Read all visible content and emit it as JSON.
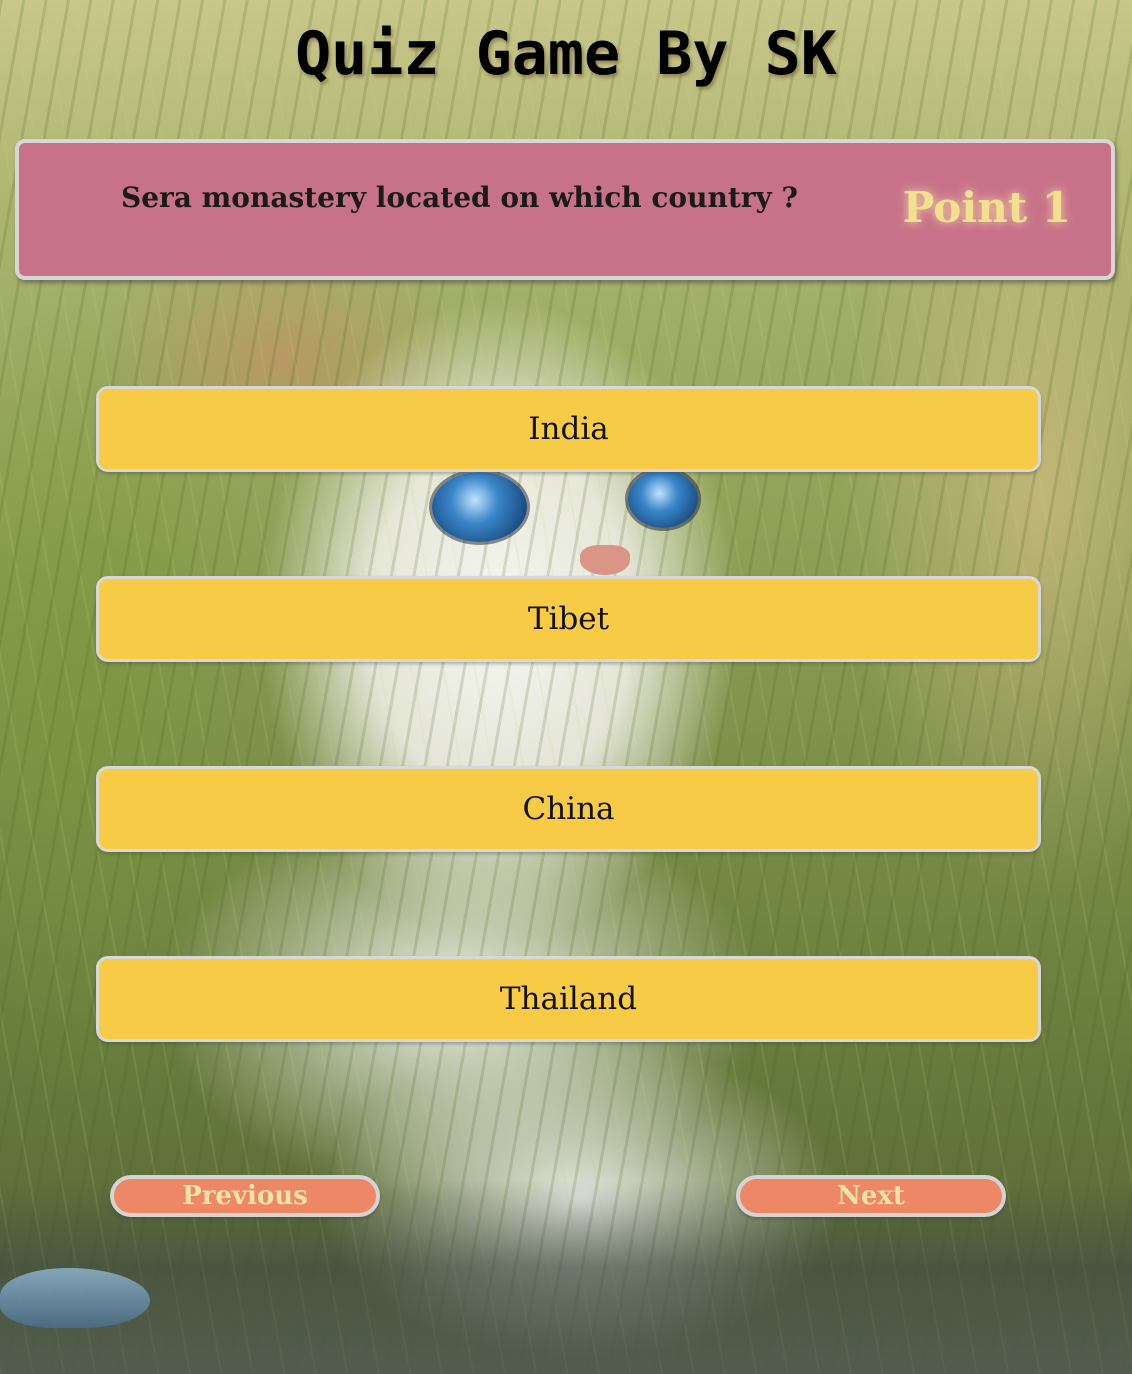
{
  "page": {
    "title": "Quiz Game By SK"
  },
  "question": {
    "text": "Sera monastery located on which country ?",
    "score_label": "Point 1"
  },
  "options": [
    {
      "label": "India"
    },
    {
      "label": "Tibet"
    },
    {
      "label": "China"
    },
    {
      "label": "Thailand"
    }
  ],
  "navigation": {
    "previous_label": "Previous",
    "next_label": "Next"
  },
  "colors": {
    "question_panel": "#c8728a",
    "score_text": "#f1e08e",
    "option_button": "#f7cb45",
    "nav_button": "#ee8766",
    "nav_text": "#f3e3a4"
  }
}
